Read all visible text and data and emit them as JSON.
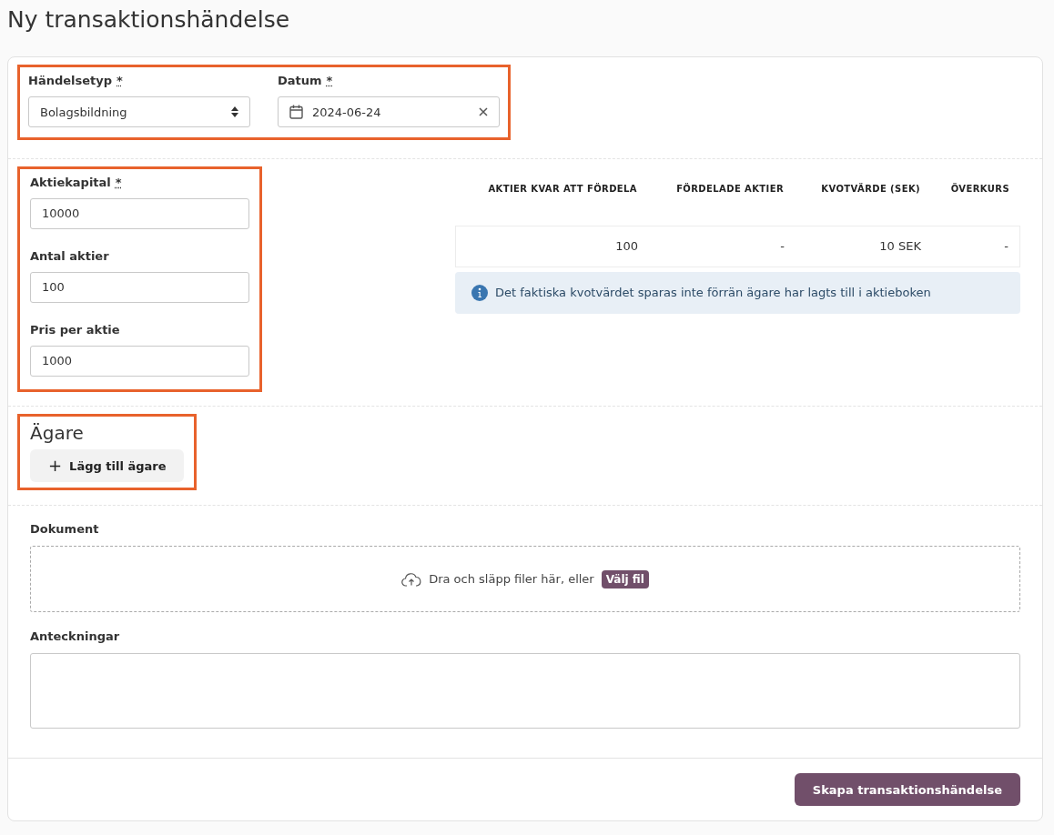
{
  "page_title": "Ny transaktionshändelse",
  "event_section": {
    "highlighted": true,
    "fields": [
      {
        "kind": "select",
        "label": "Händelsetyp",
        "required_mark": "*",
        "value": "Bolagsbildning"
      },
      {
        "kind": "date",
        "label": "Datum",
        "required_mark": "*",
        "value": "2024-06-24"
      }
    ]
  },
  "capital_section": {
    "highlighted": true,
    "fields": [
      {
        "kind": "text",
        "label": "Aktiekapital",
        "required_mark": "*",
        "value": "10000"
      },
      {
        "kind": "text",
        "label": "Antal aktier",
        "value": "100"
      },
      {
        "kind": "text",
        "label": "Pris per aktie",
        "value": "1000"
      }
    ]
  },
  "share_table": {
    "columns": [
      "AKTIER KVAR ATT FÖRDELA",
      "FÖRDELADE AKTIER",
      "KVOTVÄRDE (SEK)",
      "ÖVERKURS"
    ],
    "row": [
      "100",
      "-",
      "10 SEK",
      "-"
    ],
    "info": "Det faktiska kvotvärdet sparas inte förrän ägare har lagts till i aktieboken"
  },
  "owners_section": {
    "highlighted": true,
    "heading": "Ägare",
    "add_button": {
      "icon": "+",
      "label": "Lägg till ägare"
    }
  },
  "documents": {
    "label": "Dokument",
    "dropzone_text": "Dra och släpp filer här, eller",
    "choose_button": "Välj fil"
  },
  "notes": {
    "label": "Anteckningar"
  },
  "submit_button": "Skapa transaktionshändelse"
}
